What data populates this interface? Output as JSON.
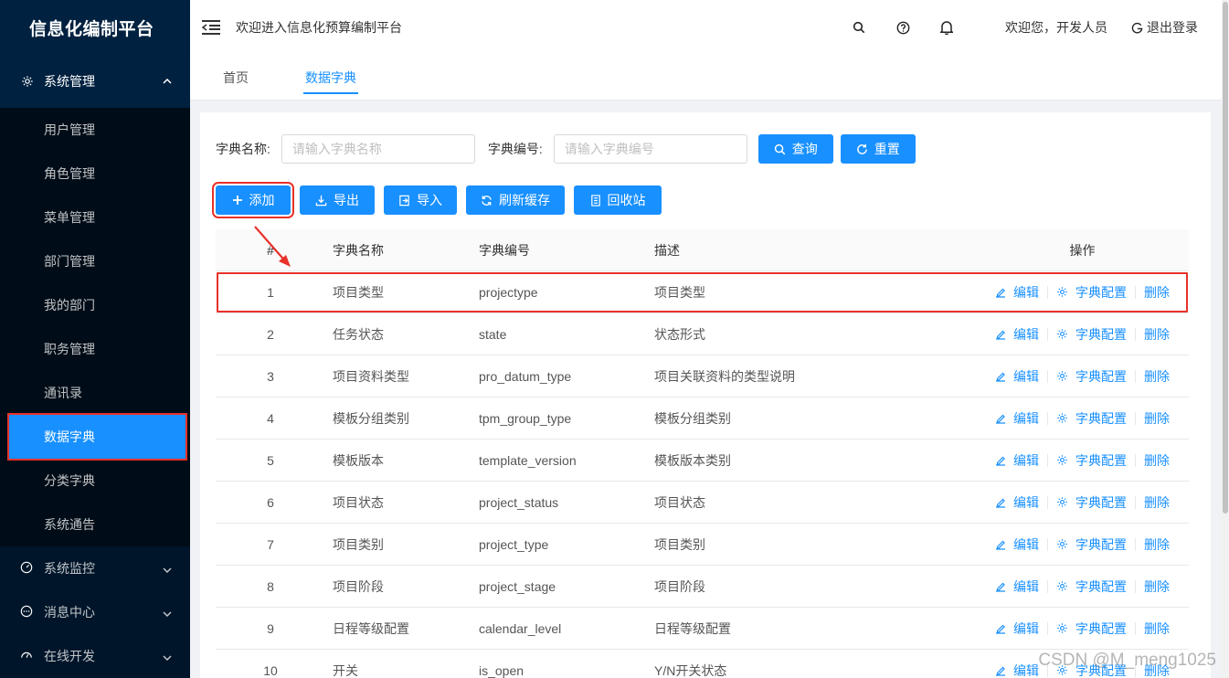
{
  "app": {
    "title": "信息化编制平台",
    "welcome": "欢迎进入信息化预算编制平台",
    "user_greeting": "欢迎您，开发人员",
    "logout": "退出登录"
  },
  "sidebar": {
    "system_group": "系统管理",
    "items": [
      {
        "label": "用户管理"
      },
      {
        "label": "角色管理"
      },
      {
        "label": "菜单管理"
      },
      {
        "label": "部门管理"
      },
      {
        "label": "我的部门"
      },
      {
        "label": "职务管理"
      },
      {
        "label": "通讯录"
      },
      {
        "label": "数据字典",
        "active": true
      },
      {
        "label": "分类字典"
      },
      {
        "label": "系统通告"
      }
    ],
    "collapsed": [
      {
        "label": "系统监控",
        "icon": "dashboard-icon"
      },
      {
        "label": "消息中心",
        "icon": "message-icon"
      },
      {
        "label": "在线开发",
        "icon": "dev-icon"
      }
    ]
  },
  "tabs": [
    {
      "label": "首页"
    },
    {
      "label": "数据字典",
      "active": true
    }
  ],
  "search": {
    "name_label": "字典名称:",
    "name_placeholder": "请输入字典名称",
    "code_label": "字典编号:",
    "code_placeholder": "请输入字典编号",
    "query": "查询",
    "reset": "重置"
  },
  "toolbar": {
    "add": "添加",
    "export": "导出",
    "import": "导入",
    "refresh_cache": "刷新缓存",
    "recycle": "回收站"
  },
  "table": {
    "headers": {
      "idx": "#",
      "name": "字典名称",
      "code": "字典编号",
      "desc": "描述",
      "op": "操作"
    },
    "actions": {
      "edit": "编辑",
      "config": "字典配置",
      "delete": "删除"
    },
    "rows": [
      {
        "idx": "1",
        "name": "项目类型",
        "code": "projectype",
        "desc": "项目类型"
      },
      {
        "idx": "2",
        "name": "任务状态",
        "code": "state",
        "desc": "状态形式"
      },
      {
        "idx": "3",
        "name": "项目资料类型",
        "code": "pro_datum_type",
        "desc": "项目关联资料的类型说明"
      },
      {
        "idx": "4",
        "name": "模板分组类别",
        "code": "tpm_group_type",
        "desc": "模板分组类别"
      },
      {
        "idx": "5",
        "name": "模板版本",
        "code": "template_version",
        "desc": "模板版本类别"
      },
      {
        "idx": "6",
        "name": "项目状态",
        "code": "project_status",
        "desc": "项目状态"
      },
      {
        "idx": "7",
        "name": "项目类别",
        "code": "project_type",
        "desc": "项目类别"
      },
      {
        "idx": "8",
        "name": "项目阶段",
        "code": "project_stage",
        "desc": "项目阶段"
      },
      {
        "idx": "9",
        "name": "日程等级配置",
        "code": "calendar_level",
        "desc": "日程等级配置"
      },
      {
        "idx": "10",
        "name": "开关",
        "code": "is_open",
        "desc": "Y/N开关状态"
      }
    ]
  },
  "watermark": "CSDN @M_meng1025",
  "colors": {
    "primary": "#1890ff",
    "sidebar_bg": "#001529",
    "highlight": "#e8312a"
  }
}
